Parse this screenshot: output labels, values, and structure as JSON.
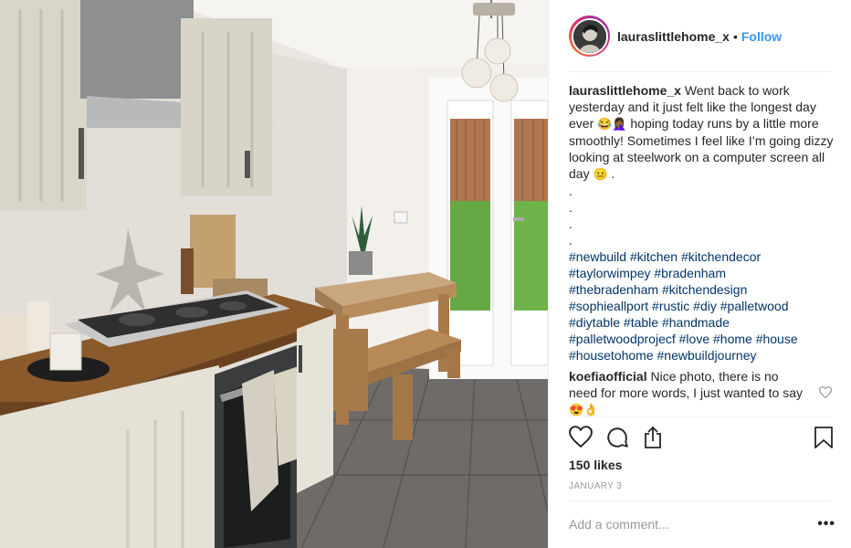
{
  "post": {
    "username": "lauraslittlehome_x",
    "separator": "•",
    "follow_label": "Follow",
    "photo_alt": "Kitchen with dining table",
    "caption": {
      "username": "lauraslittlehome_x",
      "text_1": "Went back to work yesterday and it just felt like the longest day ever",
      "emoji_1": "😂🤦🏾‍♀️",
      "text_2": "hoping today runs by a little more smoothly! Sometimes I feel like I’m going dizzy looking at steelwork on a computer screen all day",
      "emoji_2": "😐",
      "text_3": ".",
      "dots": [
        ".",
        ".",
        ".",
        "."
      ],
      "hashtag_lines": [
        "#newbuild #kitchen #kitchendecor",
        "#taylorwimpey #bradenham",
        "#thebradenham #kitchendesign",
        "#sophieallport #rustic #diy #palletwood",
        "#diytable #table #handmade",
        "#palletwoodprojecf #love #home #house",
        "#housetohome #newbuildjourney"
      ]
    },
    "comment": {
      "username": "koefiaofficial",
      "text": "Nice photo, there is no need for more words, I just wanted to say",
      "emoji": "😍👌"
    },
    "likes": "150 likes",
    "date": "JANUARY 3",
    "add_comment_placeholder": "Add a comment...",
    "more_label": "•••"
  },
  "icons": {
    "like": "heart-icon",
    "comment": "comment-icon",
    "share": "share-icon",
    "save": "bookmark-icon",
    "comment_like": "heart-icon"
  },
  "colors": {
    "follow": "#3897f0",
    "hashtag": "#003569",
    "muted": "#999999",
    "text": "#262626"
  }
}
